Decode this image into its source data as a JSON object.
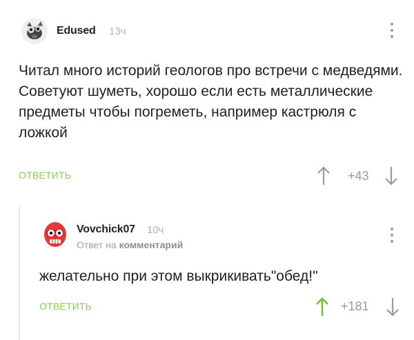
{
  "comments": [
    {
      "author": "Edused",
      "time": "13ч",
      "text": "Читал много историй геологов про встречи с медведями. Советуют шуметь, хорошо если есть металлические предметы чтобы погреметь, например кастрюля с ложкой",
      "reply_label": "ОТВЕТИТЬ",
      "rating": "+43",
      "upvoted": false
    },
    {
      "author": "Vovchick07",
      "time": "10ч",
      "reply_to_prefix": "Ответ на",
      "reply_to_target": "комментарий",
      "text": "желательно при этом выкрикивать\"обед!\"",
      "reply_label": "ОТВЕТИТЬ",
      "rating": "+181",
      "upvoted": true
    }
  ],
  "colors": {
    "accent_green": "#8ac858",
    "muted_gray": "#9a9a9a",
    "thread_line": "#e6e6e6"
  }
}
